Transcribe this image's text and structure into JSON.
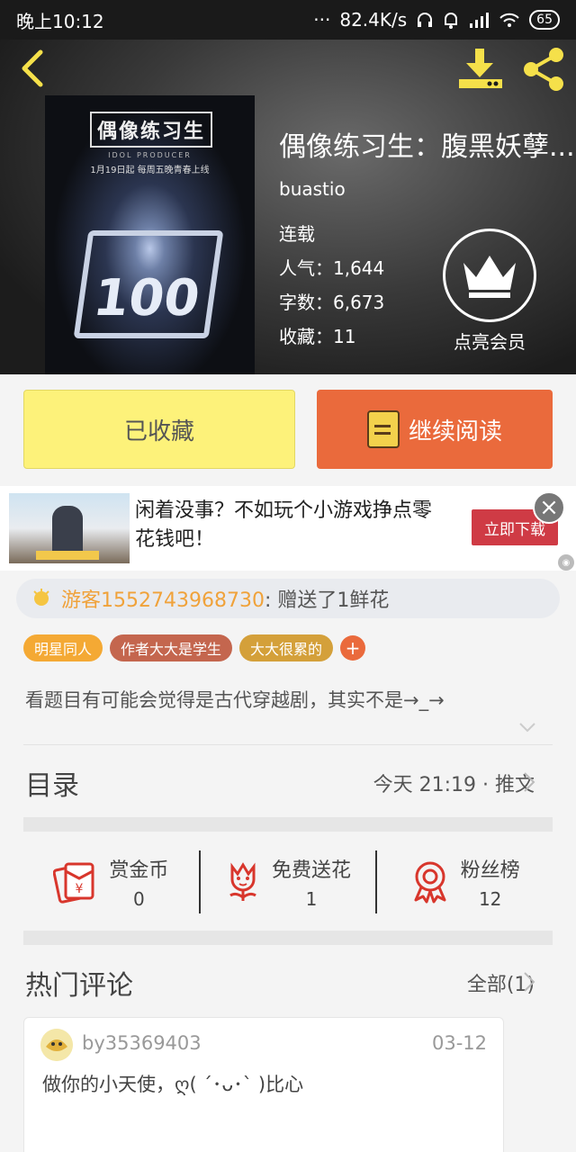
{
  "statusbar": {
    "time": "晚上10:12",
    "dots": "···",
    "speed": "82.4K/s",
    "battery": "65"
  },
  "book": {
    "title": "偶像练习生：腹黑妖孽...",
    "author": "buastio",
    "status": "连载",
    "popularity": "人气：1,644",
    "word_count": "字数：6,673",
    "favorites": "收藏：11",
    "cover": {
      "logo": "偶像练习生",
      "sub": "IDOL PRODUCER",
      "date": "1月19日起 每周五晚青春上线",
      "mark": "100"
    }
  },
  "vip": {
    "label": "点亮会员"
  },
  "actions": {
    "favorited": "已收藏",
    "continue": "继续阅读"
  },
  "ad": {
    "text": "闲着没事？不如玩个小游戏挣点零花钱吧！",
    "cta": "立即下载",
    "close": "×"
  },
  "gift": {
    "user": "游客1552743968730",
    "message": " : 赠送了1鲜花"
  },
  "tags": [
    {
      "label": "明星同人",
      "color": "#f4a934"
    },
    {
      "label": "作者大大是学生",
      "color": "#c4664e"
    },
    {
      "label": "大大很累的",
      "color": "#d4a03a"
    }
  ],
  "tag_add": "+",
  "summary": "看题目有可能会觉得是古代穿越剧，其实不是→_→",
  "toc": {
    "title": "目录",
    "info": "今天 21:19 · 推文"
  },
  "stats": [
    {
      "label": "赏金币",
      "value": "0",
      "icon": "red-envelope-icon"
    },
    {
      "label": "免费送花",
      "value": "1",
      "icon": "flower-icon"
    },
    {
      "label": "粉丝榜",
      "value": "12",
      "icon": "medal-icon"
    }
  ],
  "hot_comments": {
    "title": "热门评论",
    "all": "全部(1)"
  },
  "comment": {
    "user": "by35369403",
    "date": "03-12",
    "text": "做你的小天使，ღ( ´･ᴗ･` )比心"
  },
  "colors": {
    "accent": "#ea6a3c",
    "fav_bg": "#fdf27a",
    "ad_cta": "#cf3b45",
    "icon_red": "#d8362c"
  }
}
